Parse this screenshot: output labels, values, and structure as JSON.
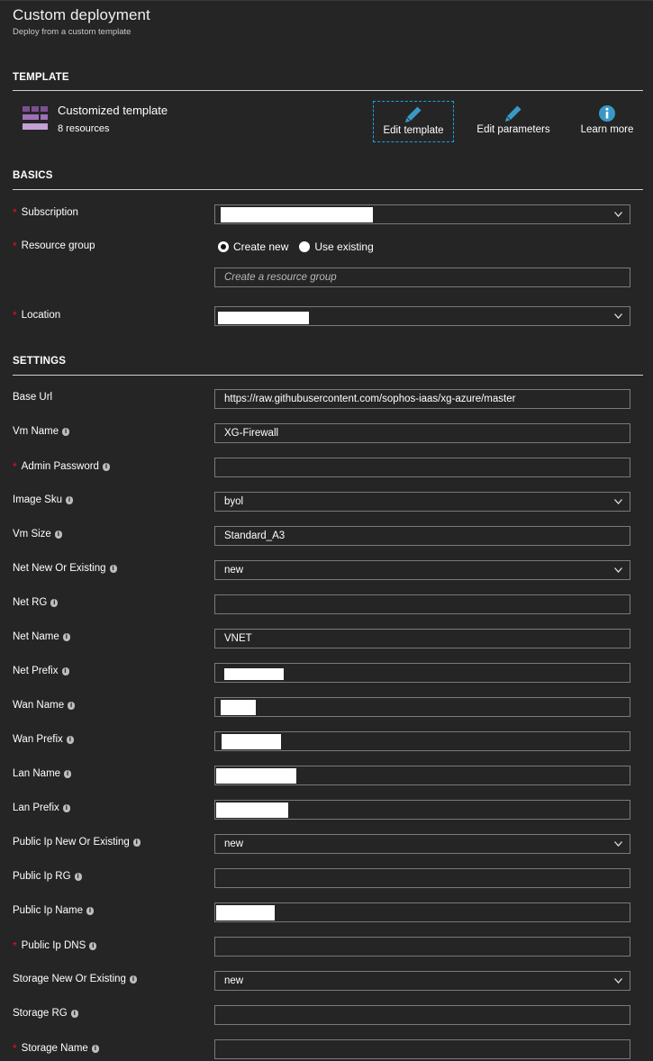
{
  "header": {
    "title": "Custom deployment",
    "subtitle": "Deploy from a custom template"
  },
  "template_section": {
    "heading": "TEMPLATE",
    "template_name": "Customized template",
    "resource_count": "8 resources",
    "icon": "template-blocks-icon",
    "icon_colors": [
      "#7d4f91",
      "#9f6fb8",
      "#c3a1d6"
    ],
    "actions": [
      {
        "label": "Edit template",
        "icon": "pencil-icon"
      },
      {
        "label": "Edit parameters",
        "icon": "pencil-icon"
      },
      {
        "label": "Learn more",
        "icon": "info-icon"
      }
    ],
    "accent_color": "#3999c6"
  },
  "basics_section": {
    "heading": "BASICS",
    "subscription": {
      "label": "Subscription",
      "required": true,
      "value": ""
    },
    "resource_group": {
      "label": "Resource group",
      "required": true,
      "options": [
        "Create new",
        "Use existing"
      ],
      "selected": "Create new",
      "placeholder": "Create a resource group",
      "value": ""
    },
    "location": {
      "label": "Location",
      "required": true,
      "value": ""
    }
  },
  "settings_section": {
    "heading": "SETTINGS",
    "fields": [
      {
        "label": "Base Url",
        "required": false,
        "info": false,
        "type": "text",
        "value": "https://raw.githubusercontent.com/sophos-iaas/xg-azure/master"
      },
      {
        "label": "Vm Name",
        "required": false,
        "info": true,
        "type": "text",
        "value": "XG-Firewall"
      },
      {
        "label": "Admin Password",
        "required": true,
        "info": true,
        "type": "text",
        "value": ""
      },
      {
        "label": "Image Sku",
        "required": false,
        "info": true,
        "type": "select",
        "value": "byol"
      },
      {
        "label": "Vm Size",
        "required": false,
        "info": true,
        "type": "text",
        "value": "Standard_A3"
      },
      {
        "label": "Net New Or Existing",
        "required": false,
        "info": true,
        "type": "select",
        "value": "new"
      },
      {
        "label": "Net RG",
        "required": false,
        "info": true,
        "type": "text",
        "value": ""
      },
      {
        "label": "Net Name",
        "required": false,
        "info": true,
        "type": "text",
        "value": "VNET"
      },
      {
        "label": "Net Prefix",
        "required": false,
        "info": true,
        "type": "text",
        "value": "",
        "redacted": true
      },
      {
        "label": "Wan Name",
        "required": false,
        "info": true,
        "type": "text",
        "value": "",
        "redacted": true
      },
      {
        "label": "Wan Prefix",
        "required": false,
        "info": true,
        "type": "text",
        "value": "",
        "redacted": true
      },
      {
        "label": "Lan Name",
        "required": false,
        "info": true,
        "type": "text",
        "value": "",
        "redacted": true
      },
      {
        "label": "Lan Prefix",
        "required": false,
        "info": true,
        "type": "text",
        "value": "",
        "redacted": true
      },
      {
        "label": "Public Ip New Or Existing",
        "required": false,
        "info": true,
        "type": "select",
        "value": "new"
      },
      {
        "label": "Public Ip RG",
        "required": false,
        "info": true,
        "type": "text",
        "value": ""
      },
      {
        "label": "Public Ip Name",
        "required": false,
        "info": true,
        "type": "text",
        "value": "",
        "redacted": true
      },
      {
        "label": "Public Ip DNS",
        "required": true,
        "info": true,
        "type": "text",
        "value": ""
      },
      {
        "label": "Storage New Or Existing",
        "required": false,
        "info": true,
        "type": "select",
        "value": "new"
      },
      {
        "label": "Storage RG",
        "required": false,
        "info": true,
        "type": "text",
        "value": ""
      },
      {
        "label": "Storage Name",
        "required": true,
        "info": true,
        "type": "text",
        "value": ""
      }
    ]
  },
  "info_glyph": "i",
  "required_marker": "*"
}
